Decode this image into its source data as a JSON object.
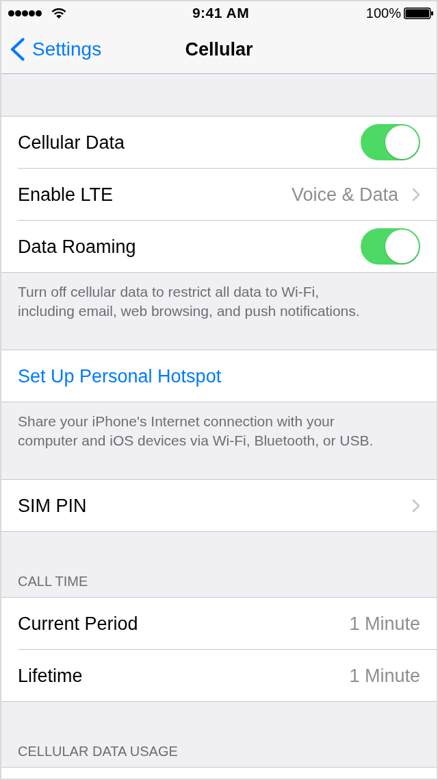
{
  "status_bar": {
    "time": "9:41 AM",
    "battery": "100%"
  },
  "nav_bar": {
    "back_label": "Settings",
    "title": "Cellular"
  },
  "sections": [
    {
      "rows": [
        {
          "kind": "toggle",
          "label": "Cellular Data",
          "on": true
        },
        {
          "kind": "disclosure",
          "label": "Enable LTE",
          "value": "Voice & Data"
        },
        {
          "kind": "toggle",
          "label": "Data Roaming",
          "on": true
        }
      ],
      "footer": "Turn off cellular data to restrict all data to Wi-Fi, including email, web browsing, and push notifications."
    },
    {
      "rows": [
        {
          "kind": "action",
          "label": "Set Up Personal Hotspot"
        }
      ],
      "footer": "Share your iPhone's Internet connection with your computer and iOS devices via Wi-Fi, Bluetooth, or USB."
    },
    {
      "rows": [
        {
          "kind": "disclosure",
          "label": "SIM PIN"
        }
      ]
    },
    {
      "header": "CALL TIME",
      "rows": [
        {
          "kind": "value",
          "label": "Current Period",
          "value": "1 Minute"
        },
        {
          "kind": "value",
          "label": "Lifetime",
          "value": "1 Minute"
        }
      ]
    },
    {
      "header": "CELLULAR DATA USAGE"
    }
  ]
}
